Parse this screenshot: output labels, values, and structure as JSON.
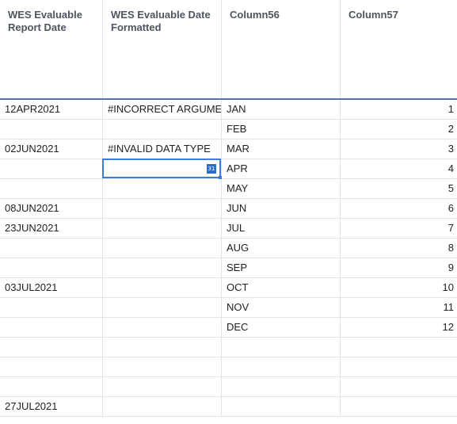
{
  "headers": [
    "WES Evaluable Report Date",
    "WES Evaluable Date Formatted",
    "Column56",
    "Column57"
  ],
  "rows": [
    [
      "12APR2021",
      "#INCORRECT ARGUMENT",
      "JAN",
      "1"
    ],
    [
      "",
      "",
      "FEB",
      "2"
    ],
    [
      "02JUN2021",
      "#INVALID DATA TYPE",
      "MAR",
      "3"
    ],
    [
      "",
      "",
      "APR",
      "4"
    ],
    [
      "",
      "",
      "MAY",
      "5"
    ],
    [
      "08JUN2021",
      "",
      "JUN",
      "6"
    ],
    [
      "23JUN2021",
      "",
      "JUL",
      "7"
    ],
    [
      "",
      "",
      "AUG",
      "8"
    ],
    [
      "",
      "",
      "SEP",
      "9"
    ],
    [
      "03JUL2021",
      "",
      "OCT",
      "10"
    ],
    [
      "",
      "",
      "NOV",
      "11"
    ],
    [
      "",
      "",
      "DEC",
      "12"
    ],
    [
      "",
      "",
      "",
      ""
    ],
    [
      "",
      "",
      "",
      ""
    ],
    [
      "",
      "",
      "",
      ""
    ],
    [
      "27JUL2021",
      "",
      "",
      ""
    ]
  ],
  "selected_cell_icon": "31",
  "colors": {
    "header_border": "#5a6fa8",
    "selection": "#3b7ddd",
    "grid": "#e3e3e3"
  }
}
